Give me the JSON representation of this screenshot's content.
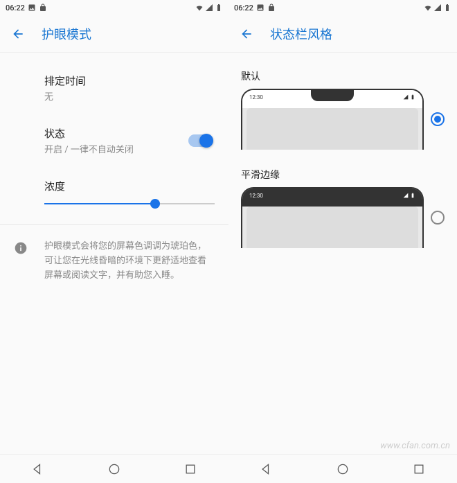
{
  "status_bar": {
    "time": "06:22"
  },
  "left": {
    "title": "护眼模式",
    "schedule": {
      "label": "排定时间",
      "value": "无"
    },
    "status": {
      "label": "状态",
      "value": "开启 / 一律不自动关闭",
      "on": true
    },
    "intensity": {
      "label": "浓度",
      "percent": 65
    },
    "info": "护眼模式会将您的屏幕色调调为琥珀色，可让您在光线昏暗的环境下更舒适地查看屏幕或阅读文字，并有助您入睡。"
  },
  "right": {
    "title": "状态栏风格",
    "options": [
      {
        "label": "默认",
        "preview_time": "12:30",
        "selected": true
      },
      {
        "label": "平滑边缘",
        "preview_time": "12:30",
        "selected": false
      }
    ]
  },
  "watermark": "www.cfan.com.cn"
}
